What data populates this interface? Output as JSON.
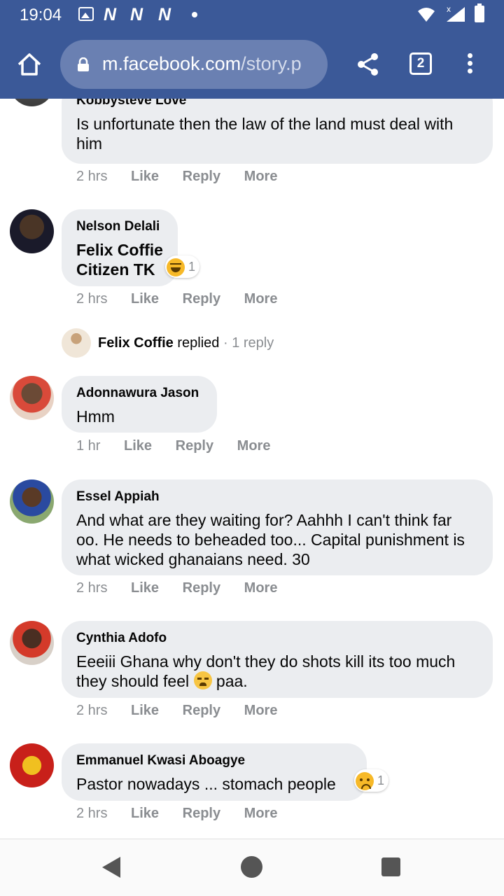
{
  "status_bar": {
    "time": "19:04",
    "notification_icons": [
      "N",
      "N",
      "N"
    ],
    "signal_label": "x"
  },
  "browser": {
    "url_host": "m.facebook.com",
    "url_path": "/story.p",
    "tab_count": "2"
  },
  "comments": [
    {
      "author": "Kobbysteve Love",
      "text": "Is unfortunate then the law of the land must deal with him",
      "time": "2 hrs",
      "like": "Like",
      "reply": "Reply",
      "more": "More"
    },
    {
      "author": "Nelson Delali",
      "text": "Felix Coffie Citizen TK",
      "time": "2 hrs",
      "like": "Like",
      "reply": "Reply",
      "more": "More",
      "reaction_count": "1"
    },
    {
      "author": "Adonnawura Jason",
      "text": "Hmm",
      "time": "1 hr",
      "like": "Like",
      "reply": "Reply",
      "more": "More"
    },
    {
      "author": "Essel Appiah",
      "text": "And what are they waiting for? Aahhh I can't think far oo. He needs to beheaded too... Capital punishment is what wicked ghanaians need. 30",
      "time": "2 hrs",
      "like": "Like",
      "reply": "Reply",
      "more": "More"
    },
    {
      "author": "Cynthia Adofo",
      "text_before_emoji": "Eeeiii Ghana why don't they do shots kill its too much they should feel ",
      "text_after_emoji": " paa.",
      "time": "2 hrs",
      "like": "Like",
      "reply": "Reply",
      "more": "More"
    },
    {
      "author": "Emmanuel Kwasi Aboagye",
      "text": "Pastor nowadays ... stomach people",
      "time": "2 hrs",
      "like": "Like",
      "reply": "Reply",
      "more": "More",
      "reaction_count": "1"
    }
  ],
  "reply_summary": {
    "name": "Felix Coffie",
    "verb": "replied",
    "separator": " · ",
    "count": "1 reply"
  }
}
